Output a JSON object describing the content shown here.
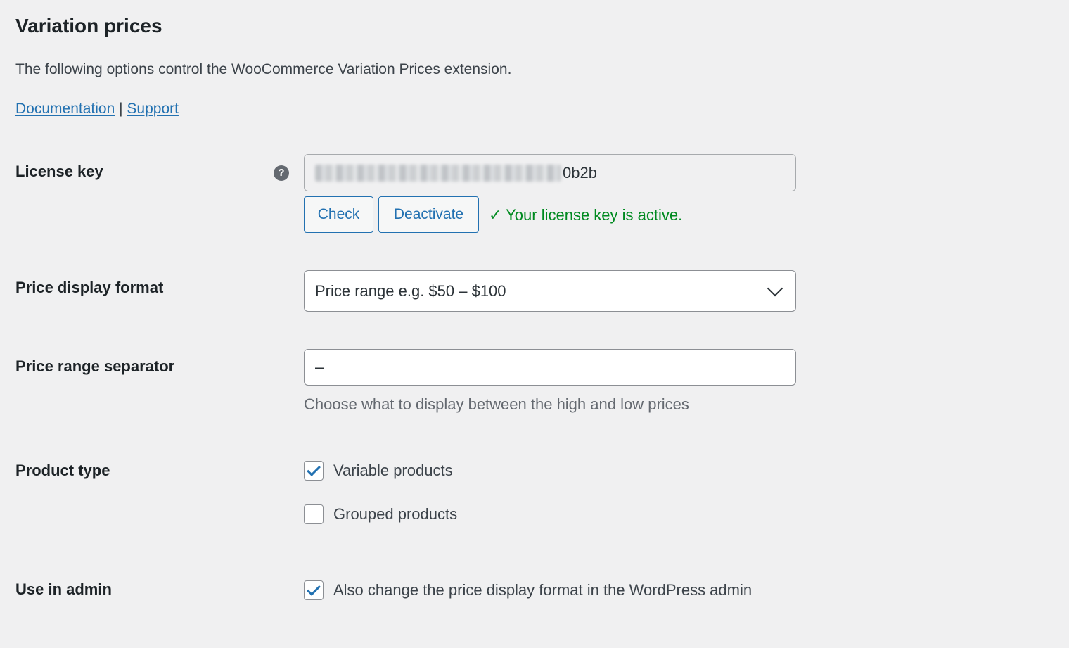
{
  "header": {
    "title": "Variation prices",
    "intro": "The following options control the WooCommerce Variation Prices extension.",
    "documentation_link": "Documentation",
    "link_divider": "|",
    "support_link": "Support"
  },
  "license": {
    "label": "License key",
    "help_icon": "?",
    "key_visible_suffix": "0b2b",
    "check_label": "Check",
    "deactivate_label": "Deactivate",
    "status": "✓ Your license key is active.",
    "status_color": "#008a20"
  },
  "price_display": {
    "label": "Price display format",
    "selected": "Price range e.g. $50 – $100"
  },
  "separator": {
    "label": "Price range separator",
    "value": "–",
    "description": "Choose what to display between the high and low prices"
  },
  "product_type": {
    "label": "Product type",
    "options": [
      {
        "label": "Variable products",
        "checked": true
      },
      {
        "label": "Grouped products",
        "checked": false
      }
    ]
  },
  "admin": {
    "label": "Use in admin",
    "option_label": "Also change the price display format in the WordPress admin",
    "checked": true
  },
  "colors": {
    "accent": "#2271b1",
    "background": "#f0f0f1"
  }
}
